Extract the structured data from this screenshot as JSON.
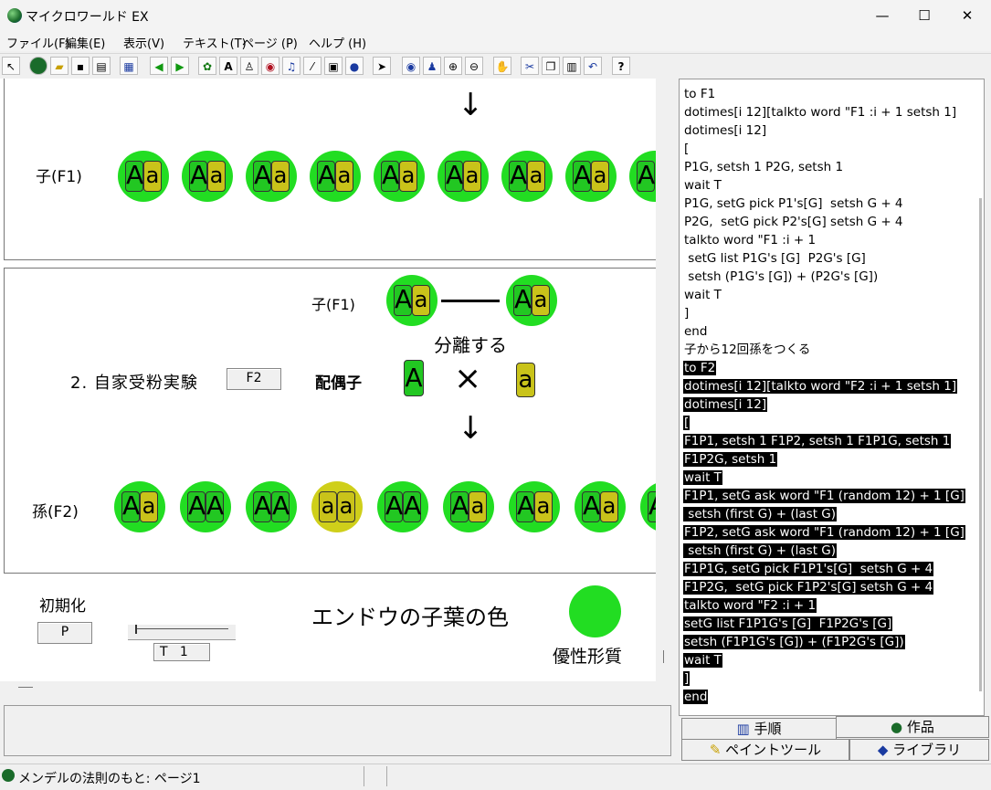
{
  "window": {
    "title": "マイクロワールド EX",
    "minimize": "—",
    "maximize": "☐",
    "close": "✕"
  },
  "menu": [
    "ファイル(F)",
    "編集(E)",
    "表示(V)",
    "テキスト(T)",
    "ページ (P)",
    "ヘルプ (H)"
  ],
  "toolbar_icons": [
    "pointer-mode-icon",
    "globe-icon",
    "open-folder-icon",
    "save-icon",
    "print-icon",
    "layout-icon",
    "back-arrow-icon",
    "forward-arrow-icon",
    "turtle-icon",
    "text-box-icon",
    "paint-bucket-icon",
    "eye-icon",
    "music-note-icon",
    "magic-wand-icon",
    "video-icon",
    "sphere-icon",
    "arrow-cursor-icon",
    "eye-tool-icon",
    "stamp-icon",
    "zoom-in-icon",
    "zoom-out-icon",
    "hand-stop-icon",
    "scissors-icon",
    "copy-icon",
    "paste-icon",
    "undo-icon",
    "help-icon"
  ],
  "canvas": {
    "f1_label": "子(F1)",
    "f1_peas": [
      "Aa",
      "Aa",
      "Aa",
      "Aa",
      "Aa",
      "Aa",
      "Aa",
      "Aa",
      "A"
    ],
    "cross": {
      "f1_label": "子(F1)",
      "parent_a": "Aa",
      "parent_b": "Aa",
      "separate_text": "分離する",
      "experiment_label": "2. 自家受粉実験",
      "f2_button": "F2",
      "gamete_label": "配偶子",
      "gamete_a": "A",
      "cross_mark": "×",
      "gamete_b": "a"
    },
    "f2_label": "孫(F2)",
    "f2_peas": [
      "Aa",
      "AA",
      "AA",
      "aa",
      "AA",
      "Aa",
      "Aa",
      "Aa",
      "A"
    ],
    "init_label": "初期化",
    "p_button": "P",
    "t_field": "T   1",
    "title": "エンドウの子葉の色",
    "trait_label": "優性形質",
    "trait_color": "#22dd22",
    "recessive_color": "#cfcf1a"
  },
  "code": {
    "lines": [
      {
        "text": "to F1",
        "hl": false
      },
      {
        "text": "dotimes[i 12][talkto word \"F1 :i + 1 setsh 1]",
        "hl": false
      },
      {
        "text": "dotimes[i 12]",
        "hl": false
      },
      {
        "text": "[",
        "hl": false
      },
      {
        "text": "P1G, setsh 1 P2G, setsh 1",
        "hl": false
      },
      {
        "text": "wait T",
        "hl": false
      },
      {
        "text": "P1G, setG pick P1's[G]  setsh G + 4",
        "hl": false
      },
      {
        "text": "P2G,  setG pick P2's[G] setsh G + 4",
        "hl": false
      },
      {
        "text": "talkto word \"F1 :i + 1",
        "hl": false
      },
      {
        "text": " setG list P1G's [G]  P2G's [G]",
        "hl": false
      },
      {
        "text": " setsh (P1G's [G]) + (P2G's [G])",
        "hl": false
      },
      {
        "text": "wait T",
        "hl": false
      },
      {
        "text": "]",
        "hl": false
      },
      {
        "text": "end",
        "hl": false
      },
      {
        "text": "子から12回孫をつくる",
        "hl": false
      },
      {
        "text": "to F2",
        "hl": true
      },
      {
        "text": "dotimes[i 12][talkto word \"F2 :i + 1 setsh 1]",
        "hl": true
      },
      {
        "text": "dotimes[i 12]",
        "hl": true
      },
      {
        "text": "[",
        "hl": true
      },
      {
        "text": "F1P1, setsh 1 F1P2, setsh 1 F1P1G, setsh 1",
        "hl": true
      },
      {
        "text": "F1P2G, setsh 1",
        "hl": true
      },
      {
        "text": "wait T",
        "hl": true
      },
      {
        "text": "F1P1, setG ask word \"F1 (random 12) + 1 [G]",
        "hl": true
      },
      {
        "text": " setsh (first G) + (last G)",
        "hl": true
      },
      {
        "text": "F1P2, setG ask word \"F1 (random 12) + 1 [G]",
        "hl": true
      },
      {
        "text": " setsh (first G) + (last G)",
        "hl": true
      },
      {
        "text": "F1P1G, setG pick F1P1's[G]  setsh G + 4",
        "hl": true
      },
      {
        "text": "F1P2G,  setG pick F1P2's[G] setsh G + 4",
        "hl": true
      },
      {
        "text": "talkto word \"F2 :i + 1",
        "hl": true
      },
      {
        "text": "setG list F1P1G's [G]  F1P2G's [G]",
        "hl": true
      },
      {
        "text": "setsh (F1P1G's [G]) + (F1P2G's [G])",
        "hl": true
      },
      {
        "text": "wait T",
        "hl": true
      },
      {
        "text": "]",
        "hl": true
      },
      {
        "text": "end",
        "hl": true
      }
    ]
  },
  "tabs": {
    "procedures": "手順",
    "works": "作品",
    "paint_tools": "ペイントツール",
    "library": "ライブラリ"
  },
  "status": {
    "page": "メンデルの法則のもと: ページ1"
  }
}
